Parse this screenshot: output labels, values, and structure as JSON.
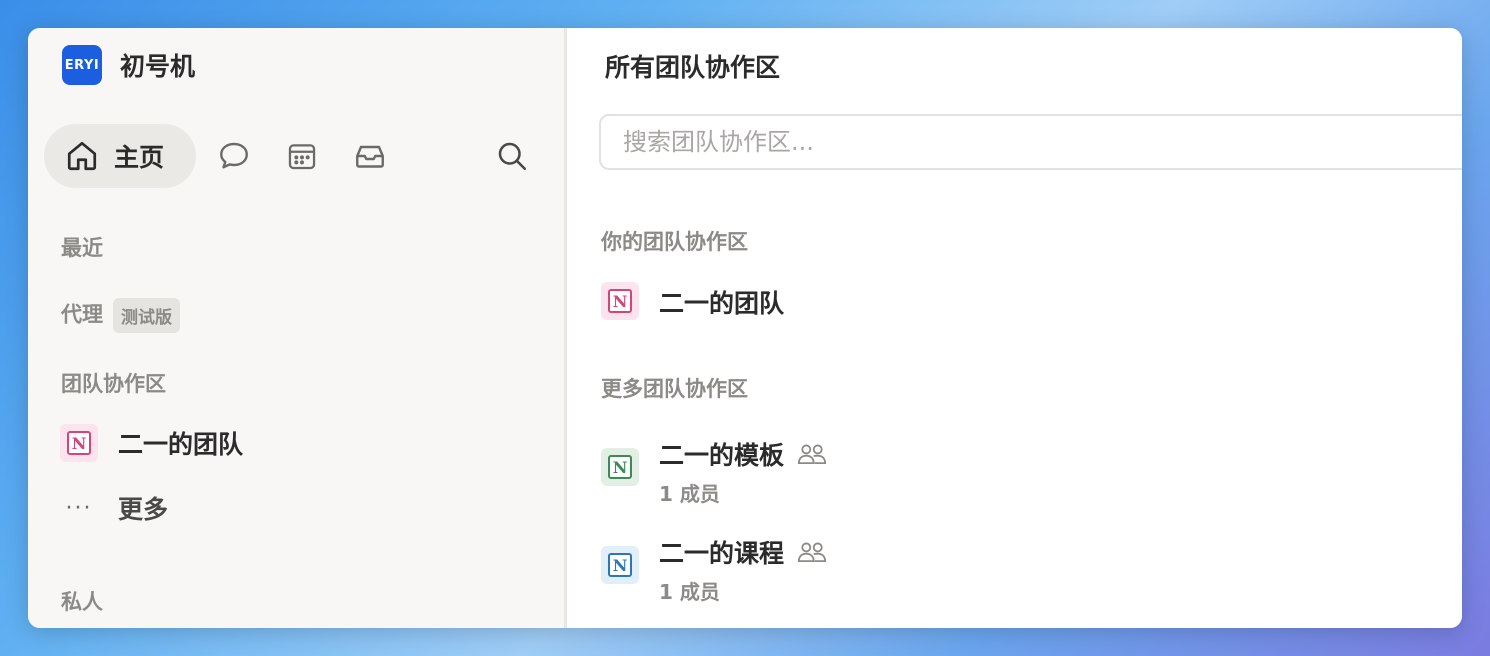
{
  "workspace": {
    "logo_text": "ERYI",
    "name": "初号机"
  },
  "nav": {
    "home_label": "主页",
    "icons": [
      "home-icon",
      "chat-icon",
      "calendar-icon",
      "inbox-icon",
      "search-icon"
    ]
  },
  "sidebar": {
    "recent_label": "最近",
    "agent_label": "代理",
    "agent_badge": "测试版",
    "teamspaces_label": "团队协作区",
    "teamspaces": [
      {
        "name": "二一的团队",
        "color": "#d6447a"
      }
    ],
    "more_dots": "···",
    "more_label": "更多",
    "private_label": "私人"
  },
  "main": {
    "title": "所有团队协作区",
    "search_placeholder": "搜索团队协作区...",
    "your_section_label": "你的团队协作区",
    "your_teams": [
      {
        "name": "二一的团队",
        "color": "#d6447a",
        "bg": "#fbe4ee"
      }
    ],
    "more_section_label": "更多团队协作区",
    "more_teams": [
      {
        "name": "二一的模板",
        "members": "1 成员",
        "color": "#3c8a55",
        "bg": "#e3efe5"
      },
      {
        "name": "二一的课程",
        "members": "1 成员",
        "color": "#2b78b8",
        "bg": "#e2eef8"
      }
    ]
  },
  "colors": {
    "accent": "#1b5fe0",
    "sidebar_bg": "#f8f7f5",
    "muted_text": "#8c8a86"
  }
}
